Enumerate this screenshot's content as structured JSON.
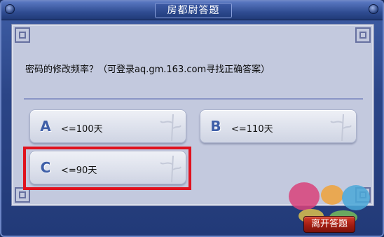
{
  "window": {
    "title": "房都尉答题"
  },
  "question": {
    "text": "密码的修改频率？（可登录aq.gm.163.com寻找正确答案）"
  },
  "options": [
    {
      "letter": "A",
      "text": "<=100天"
    },
    {
      "letter": "B",
      "text": "<=110天"
    },
    {
      "letter": "C",
      "text": "<=90天"
    }
  ],
  "selected_option": "C",
  "footer": {
    "leave_button": "离开答题"
  },
  "colors": {
    "accent_blue": "#3f5fa8",
    "selection_red": "#e0121e",
    "button_red": "#a21d12"
  }
}
